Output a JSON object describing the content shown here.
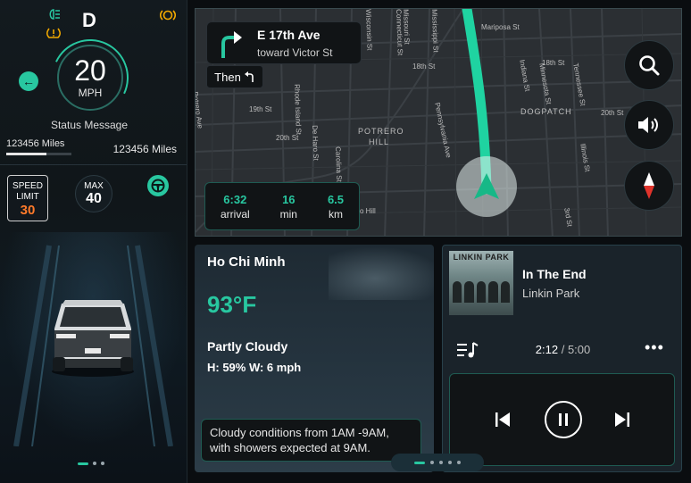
{
  "cluster": {
    "gear": "D",
    "speed": "20",
    "speed_unit": "MPH",
    "status_message": "Status Message",
    "odometer_left": "123456 Miles",
    "odometer_left_progress": 0.62,
    "odometer_right": "123456 Miles",
    "speed_limit_label_1": "SPEED",
    "speed_limit_label_2": "LIMIT",
    "speed_limit_value": "30",
    "max_label": "MAX",
    "max_value": "40",
    "indicators": [
      "headlight-icon",
      "tire-pressure-icon",
      "brake-warning-icon"
    ],
    "accent": "#28c7a0",
    "warning": "#f2a900",
    "limit_color": "#ff7a2a"
  },
  "navigation": {
    "street": "E 17th Ave",
    "toward": "toward Victor St",
    "then_label": "Then",
    "then_icon": "turn-left-icon",
    "arrival_value": "6:32",
    "arrival_label": "arrival",
    "duration_value": "16",
    "duration_label": "min",
    "distance_value": "6.5",
    "distance_label": "km",
    "map_labels": {
      "mariposa": "Mariposa St",
      "s18th": "18th St",
      "s18th_b": "18th St",
      "s19th": "19th St",
      "s20th": "20th St",
      "s20th_b": "20th St",
      "potrero_hill_1": "POTRERO",
      "potrero_hill_2": "HILL",
      "dogpatch": "DOGPATCH",
      "pennsylvania": "Pennsylvania Ave",
      "rhode_island": "Rhode Island St",
      "de_haro": "De Haro St",
      "carolina": "Carolina St",
      "wisconsin": "Wisconsin St",
      "connecticut": "Connecticut St",
      "missouri": "Missouri St",
      "mississippi": "Mississippi St",
      "indiana": "Indiana St",
      "minnesota": "Minnesota St",
      "tennessee": "Tennessee St",
      "illinois": "Illinois St",
      "third": "3rd St",
      "potrero_ave": "Potrero Ave",
      "hill": "o Hill"
    },
    "buttons": [
      "search-icon",
      "volume-icon",
      "compass-icon"
    ]
  },
  "weather": {
    "city": "Ho Chi Minh",
    "temperature": "93°F",
    "condition": "Partly Cloudy",
    "humidity_wind": "H: 59%  W: 6 mph",
    "forecast": "Cloudy conditions from 1AM -9AM, with showers expected at 9AM."
  },
  "music": {
    "album_text": "LINKIN PARK",
    "title": "In The End",
    "artist": "Linkin Park",
    "elapsed": "2:12",
    "separator": "/",
    "total": "5:00",
    "more": "•••"
  }
}
